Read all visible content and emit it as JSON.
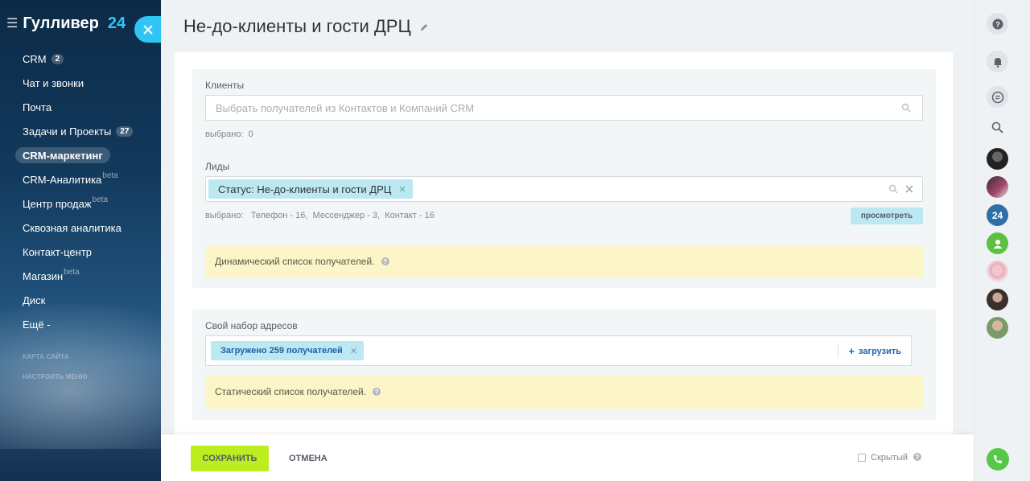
{
  "sidebar": {
    "logo": "Гулливер",
    "logo_number": "24",
    "items": [
      {
        "label": "CRM",
        "counter": "2"
      },
      {
        "label": "Чат и звонки"
      },
      {
        "label": "Почта"
      },
      {
        "label": "Задачи и Проекты",
        "counter": "27"
      },
      {
        "label": "CRM-маркетинг",
        "active": true
      },
      {
        "label": "CRM-Аналитика",
        "beta": "beta"
      },
      {
        "label": "Центр продаж",
        "beta": "beta"
      },
      {
        "label": "Сквозная аналитика"
      },
      {
        "label": "Контакт-центр"
      },
      {
        "label": "Магазин",
        "beta": "beta"
      },
      {
        "label": "Диск"
      },
      {
        "label": "Ещё -"
      }
    ],
    "sitemap": "КАРТА САЙТА",
    "configure_menu": "НАСТРОИТЬ МЕНЮ"
  },
  "page": {
    "title": "Не-до-клиенты и гости ДРЦ"
  },
  "clients": {
    "label": "Клиенты",
    "placeholder": "Выбрать получателей из Контактов и Компаний CRM",
    "selected_label": "выбрано:",
    "selected_value": "0"
  },
  "leads": {
    "label": "Лиды",
    "tag": "Статус: Не-до-клиенты и гости ДРЦ",
    "selected_label": "выбрано:",
    "selected_value": "Телефон - 16,  Мессенджер - 3,  Контакт - 16",
    "view_button": "просмотреть",
    "notice": "Динамический список получателей."
  },
  "addresses": {
    "label": "Свой набор адресов",
    "tag": "Загружено 259 получателей",
    "load_link": "загрузить",
    "notice": "Статический список получателей."
  },
  "footer": {
    "save": "СОХРАНИТЬ",
    "cancel": "ОТМЕНА",
    "hidden": "Скрытый"
  },
  "rightbar": {
    "counter_badge": "24"
  },
  "colors": {
    "accent": "#2fc6f6",
    "save_green": "#bbed21",
    "tag_blue": "#bce8f1",
    "notice_yellow": "#fbf5c8"
  }
}
